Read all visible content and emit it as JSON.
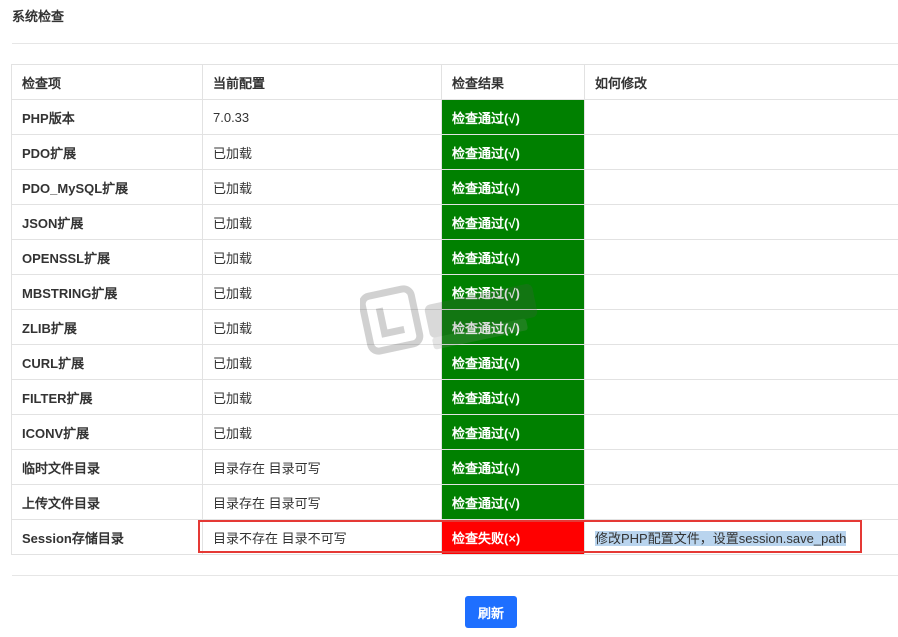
{
  "page": {
    "title": "系统检查"
  },
  "table": {
    "headers": [
      "检查项",
      "当前配置",
      "检查结果",
      "如何修改"
    ],
    "rows": [
      {
        "item": "PHP版本",
        "config": "7.0.33",
        "result": "检查通过(√)",
        "status": "pass",
        "fix": ""
      },
      {
        "item": "PDO扩展",
        "config": "已加载",
        "result": "检查通过(√)",
        "status": "pass",
        "fix": ""
      },
      {
        "item": "PDO_MySQL扩展",
        "config": "已加载",
        "result": "检查通过(√)",
        "status": "pass",
        "fix": ""
      },
      {
        "item": "JSON扩展",
        "config": "已加载",
        "result": "检查通过(√)",
        "status": "pass",
        "fix": ""
      },
      {
        "item": "OPENSSL扩展",
        "config": "已加载",
        "result": "检查通过(√)",
        "status": "pass",
        "fix": ""
      },
      {
        "item": "MBSTRING扩展",
        "config": "已加载",
        "result": "检查通过(√)",
        "status": "pass",
        "fix": ""
      },
      {
        "item": "ZLIB扩展",
        "config": "已加载",
        "result": "检查通过(√)",
        "status": "pass",
        "fix": ""
      },
      {
        "item": "CURL扩展",
        "config": "已加载",
        "result": "检查通过(√)",
        "status": "pass",
        "fix": ""
      },
      {
        "item": "FILTER扩展",
        "config": "已加载",
        "result": "检查通过(√)",
        "status": "pass",
        "fix": ""
      },
      {
        "item": "ICONV扩展",
        "config": "已加载",
        "result": "检查通过(√)",
        "status": "pass",
        "fix": ""
      },
      {
        "item": "临时文件目录",
        "config": "目录存在 目录可写",
        "result": "检查通过(√)",
        "status": "pass",
        "fix": ""
      },
      {
        "item": "上传文件目录",
        "config": "目录存在 目录可写",
        "result": "检查通过(√)",
        "status": "pass",
        "fix": ""
      },
      {
        "item": "Session存储目录",
        "config": "目录不存在 目录不可写",
        "result": "检查失败(×)",
        "status": "fail",
        "fix": "修改PHP配置文件，设置session.save_path"
      }
    ]
  },
  "actions": {
    "refresh_label": "刷新"
  },
  "watermark": {
    "icon": "watermark-logo-icon"
  },
  "colors": {
    "pass": "#008000",
    "fail": "#ff0000",
    "primary": "#1e6fff",
    "highlight": "#e53935"
  }
}
